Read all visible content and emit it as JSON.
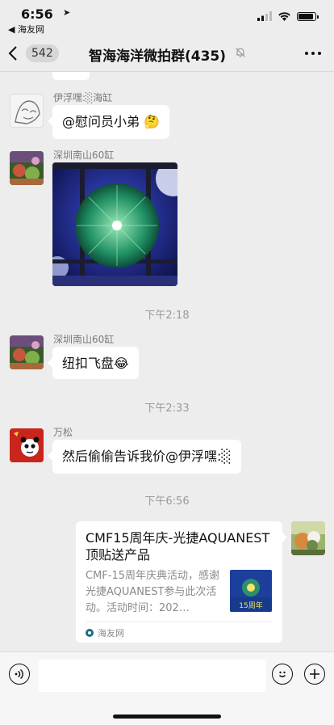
{
  "status_bar": {
    "time": "6:56",
    "back_app": "◀ 海友网"
  },
  "nav": {
    "unread_count": "542",
    "title": "智海海洋微拍群(435)"
  },
  "messages": [
    {
      "sender": "伊浮嘿:░海缸",
      "text": "@慰问员小弟 🤔"
    },
    {
      "sender": "深圳南山60缸",
      "image": "coral-photo"
    },
    {
      "sender": "深圳南山60缸",
      "text": "纽扣飞盘😂"
    },
    {
      "sender": "万松",
      "text": "然后偷偷告诉我价@伊浮嘿:░"
    }
  ],
  "timestamps": [
    "下午2:18",
    "下午2:33",
    "下午6:56"
  ],
  "link_card": {
    "title": "CMF15周年庆-光捷AQUANEST顶贴送产品",
    "description": "CMF-15周年庆典活动，感谢光捷AQUANEST参与此次活动。活动时间：202…",
    "source": "海友网",
    "thumb_text": "15周年"
  },
  "colors": {
    "background": "#ededed",
    "bubble": "#ffffff",
    "accent": "#2d5bd0"
  }
}
